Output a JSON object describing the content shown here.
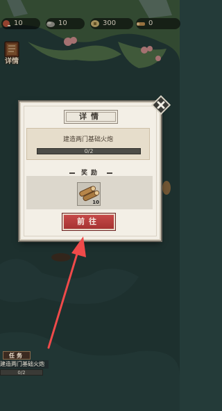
{
  "resources": {
    "items": [
      {
        "icon": "meat-icon",
        "value": "10"
      },
      {
        "icon": "stone-icon",
        "value": "10"
      },
      {
        "icon": "coin-icon",
        "value": "300"
      },
      {
        "icon": "wood-icon",
        "value": "0"
      }
    ]
  },
  "details_button": {
    "label": "详情"
  },
  "dialog": {
    "title": "详情",
    "task": {
      "name": "建造两门基础火炮",
      "progress_text": "0/2",
      "progress": 0
    },
    "reward_label": "奖励",
    "reward": {
      "icon": "wood-logs-icon",
      "count": "10"
    },
    "go_button": "前往"
  },
  "quest_panel": {
    "title": "任务",
    "name": "建造两门基础火炮",
    "progress_text": "0/2"
  },
  "colors": {
    "sea": "#243b39",
    "dialog_bg": "#f3efe6",
    "go_button": "#b63d3c",
    "arrow": "#f04a4a",
    "progress_fill": "#8fb36a"
  }
}
